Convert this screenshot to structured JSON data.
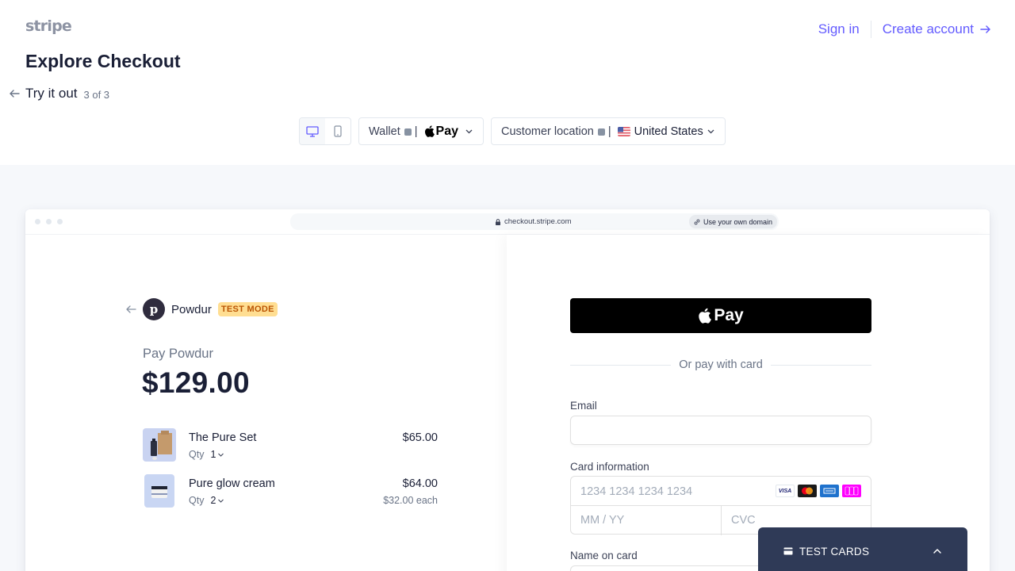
{
  "header": {
    "logo": "stripe",
    "sign_in": "Sign in",
    "create_account": "Create account",
    "title": "Explore Checkout",
    "back_label": "Try it out",
    "step": "3 of 3"
  },
  "controls": {
    "wallet_label": "Wallet",
    "wallet_value": "Pay",
    "location_label": "Customer location",
    "location_value": "United States"
  },
  "browser": {
    "url": "checkout.stripe.com",
    "domain_button": "Use your own domain"
  },
  "summary": {
    "merchant": "Powdur",
    "merchant_initial": "p",
    "mode_badge": "TEST MODE",
    "pay_label": "Pay Powdur",
    "amount": "$129.00",
    "items": [
      {
        "name": "The Pure Set",
        "qty_label": "Qty",
        "qty": "1",
        "price": "$65.00",
        "each": ""
      },
      {
        "name": "Pure glow cream",
        "qty_label": "Qty",
        "qty": "2",
        "price": "$64.00",
        "each": "$32.00 each"
      }
    ]
  },
  "payment": {
    "apple_pay": "Pay",
    "divider": "Or pay with card",
    "email_label": "Email",
    "card_label": "Card information",
    "card_number_placeholder": "1234 1234 1234 1234",
    "expiry_placeholder": "MM / YY",
    "cvc_placeholder": "CVC",
    "name_label": "Name on card",
    "brands": [
      "VISA",
      "mastercard",
      "amex",
      "jcb"
    ]
  },
  "test_cards": {
    "label": "TEST CARDS"
  },
  "colors": {
    "accent": "#635bff",
    "badge_bg": "#ffde92",
    "badge_text": "#bb5504",
    "panel_dark": "#2f3a57"
  }
}
